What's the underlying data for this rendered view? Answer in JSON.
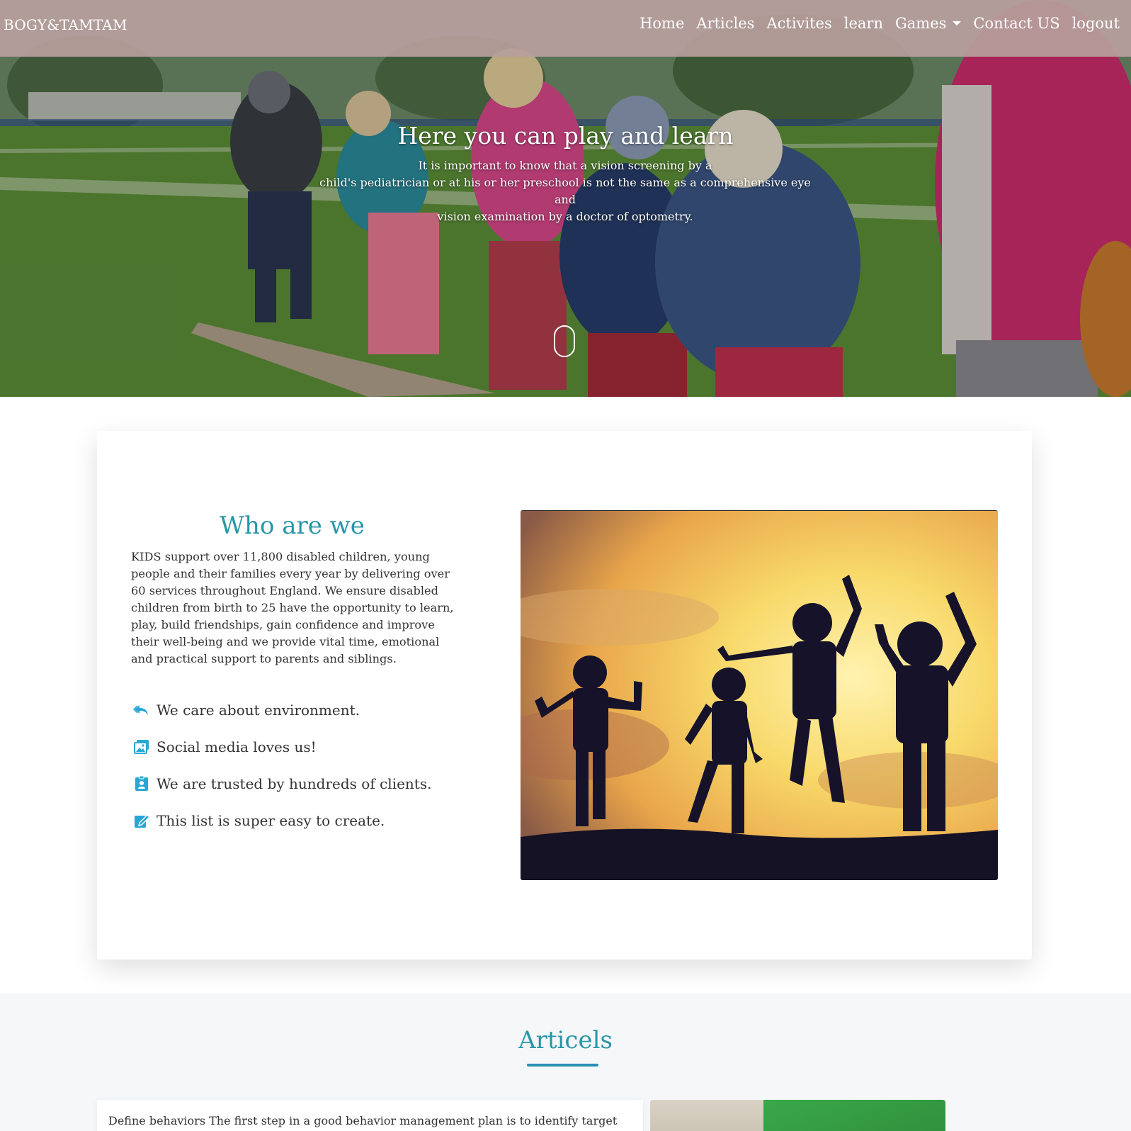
{
  "navbar": {
    "brand": "BOGY&TAMTAM",
    "items": [
      "Home",
      "Articles",
      "Activites",
      "learn",
      "Games",
      "Contact US",
      "logout"
    ]
  },
  "hero": {
    "title": "Here you can play and learn",
    "text_line1": "It is important to know that a vision screening by a",
    "text_line2": "child's pediatrician or at his or her preschool is not the same as a comprehensive eye and",
    "text_line3": "vision examination by a doctor of optometry."
  },
  "about": {
    "title": "Who are we",
    "text": "KIDS support over 11,800 disabled children, young people and their families every year by delivering over 60 services throughout England. We ensure disabled children from birth to 25 have the opportunity to learn, play, build friendships, gain confidence and improve their well-being and we provide vital time, emotional and practical support to parents and siblings.",
    "features": [
      {
        "icon": "reply-all-icon",
        "label": "We care about environment."
      },
      {
        "icon": "images-icon",
        "label": "Social media loves us!"
      },
      {
        "icon": "badge-icon",
        "label": "We are trusted by hundreds of clients."
      },
      {
        "icon": "pencil-square-icon",
        "label": "This list is super easy to create."
      }
    ]
  },
  "articles": {
    "title": "Articels",
    "first_text": "Define behaviors The first step in a good behavior management plan is to identify target"
  },
  "colors": {
    "accent": "#2796a8",
    "icon": "#27a7d6",
    "navbar": "#b79e9c",
    "underline": "#2b8fb3"
  }
}
